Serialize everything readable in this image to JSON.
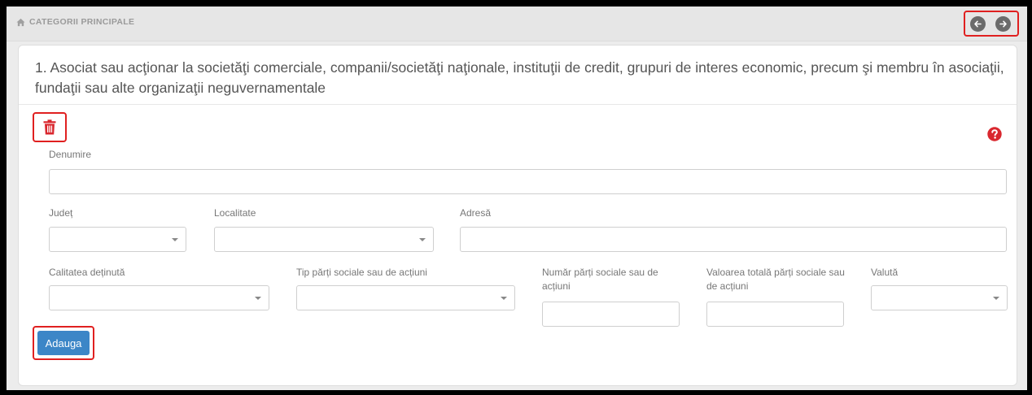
{
  "topbar": {
    "breadcrumb": "CATEGORII PRINCIPALE",
    "home_icon": "home-icon",
    "prev_icon": "arrow-left-icon",
    "next_icon": "arrow-right-icon"
  },
  "section": {
    "title": "1. Asociat sau acţionar la societăţi comerciale, companii/societăţi naţionale, instituţii de credit, grupuri de interes economic, precum şi membru în asociaţii, fundaţii sau alte organizaţii neguvernamentale"
  },
  "form": {
    "denumire": {
      "label": "Denumire",
      "value": ""
    },
    "judet": {
      "label": "Județ",
      "value": ""
    },
    "localitate": {
      "label": "Localitate",
      "value": ""
    },
    "adresa": {
      "label": "Adresă",
      "value": ""
    },
    "calitatea": {
      "label": "Calitatea deținută",
      "value": ""
    },
    "tip_parti": {
      "label": "Tip părți sociale sau de acțiuni",
      "value": ""
    },
    "numar_parti": {
      "label": "Număr părți sociale sau de acțiuni",
      "value": ""
    },
    "valoarea": {
      "label": "Valoarea totală părți sociale sau de acțiuni",
      "value": ""
    },
    "valuta": {
      "label": "Valută",
      "value": ""
    }
  },
  "actions": {
    "add_label": "Adauga",
    "delete_icon": "trash-icon",
    "help_icon": "question-circle-icon"
  },
  "colors": {
    "primary": "#3c86c7",
    "highlight": "#e02020",
    "help": "#d9272e",
    "nav_button": "#6b6b6b"
  }
}
